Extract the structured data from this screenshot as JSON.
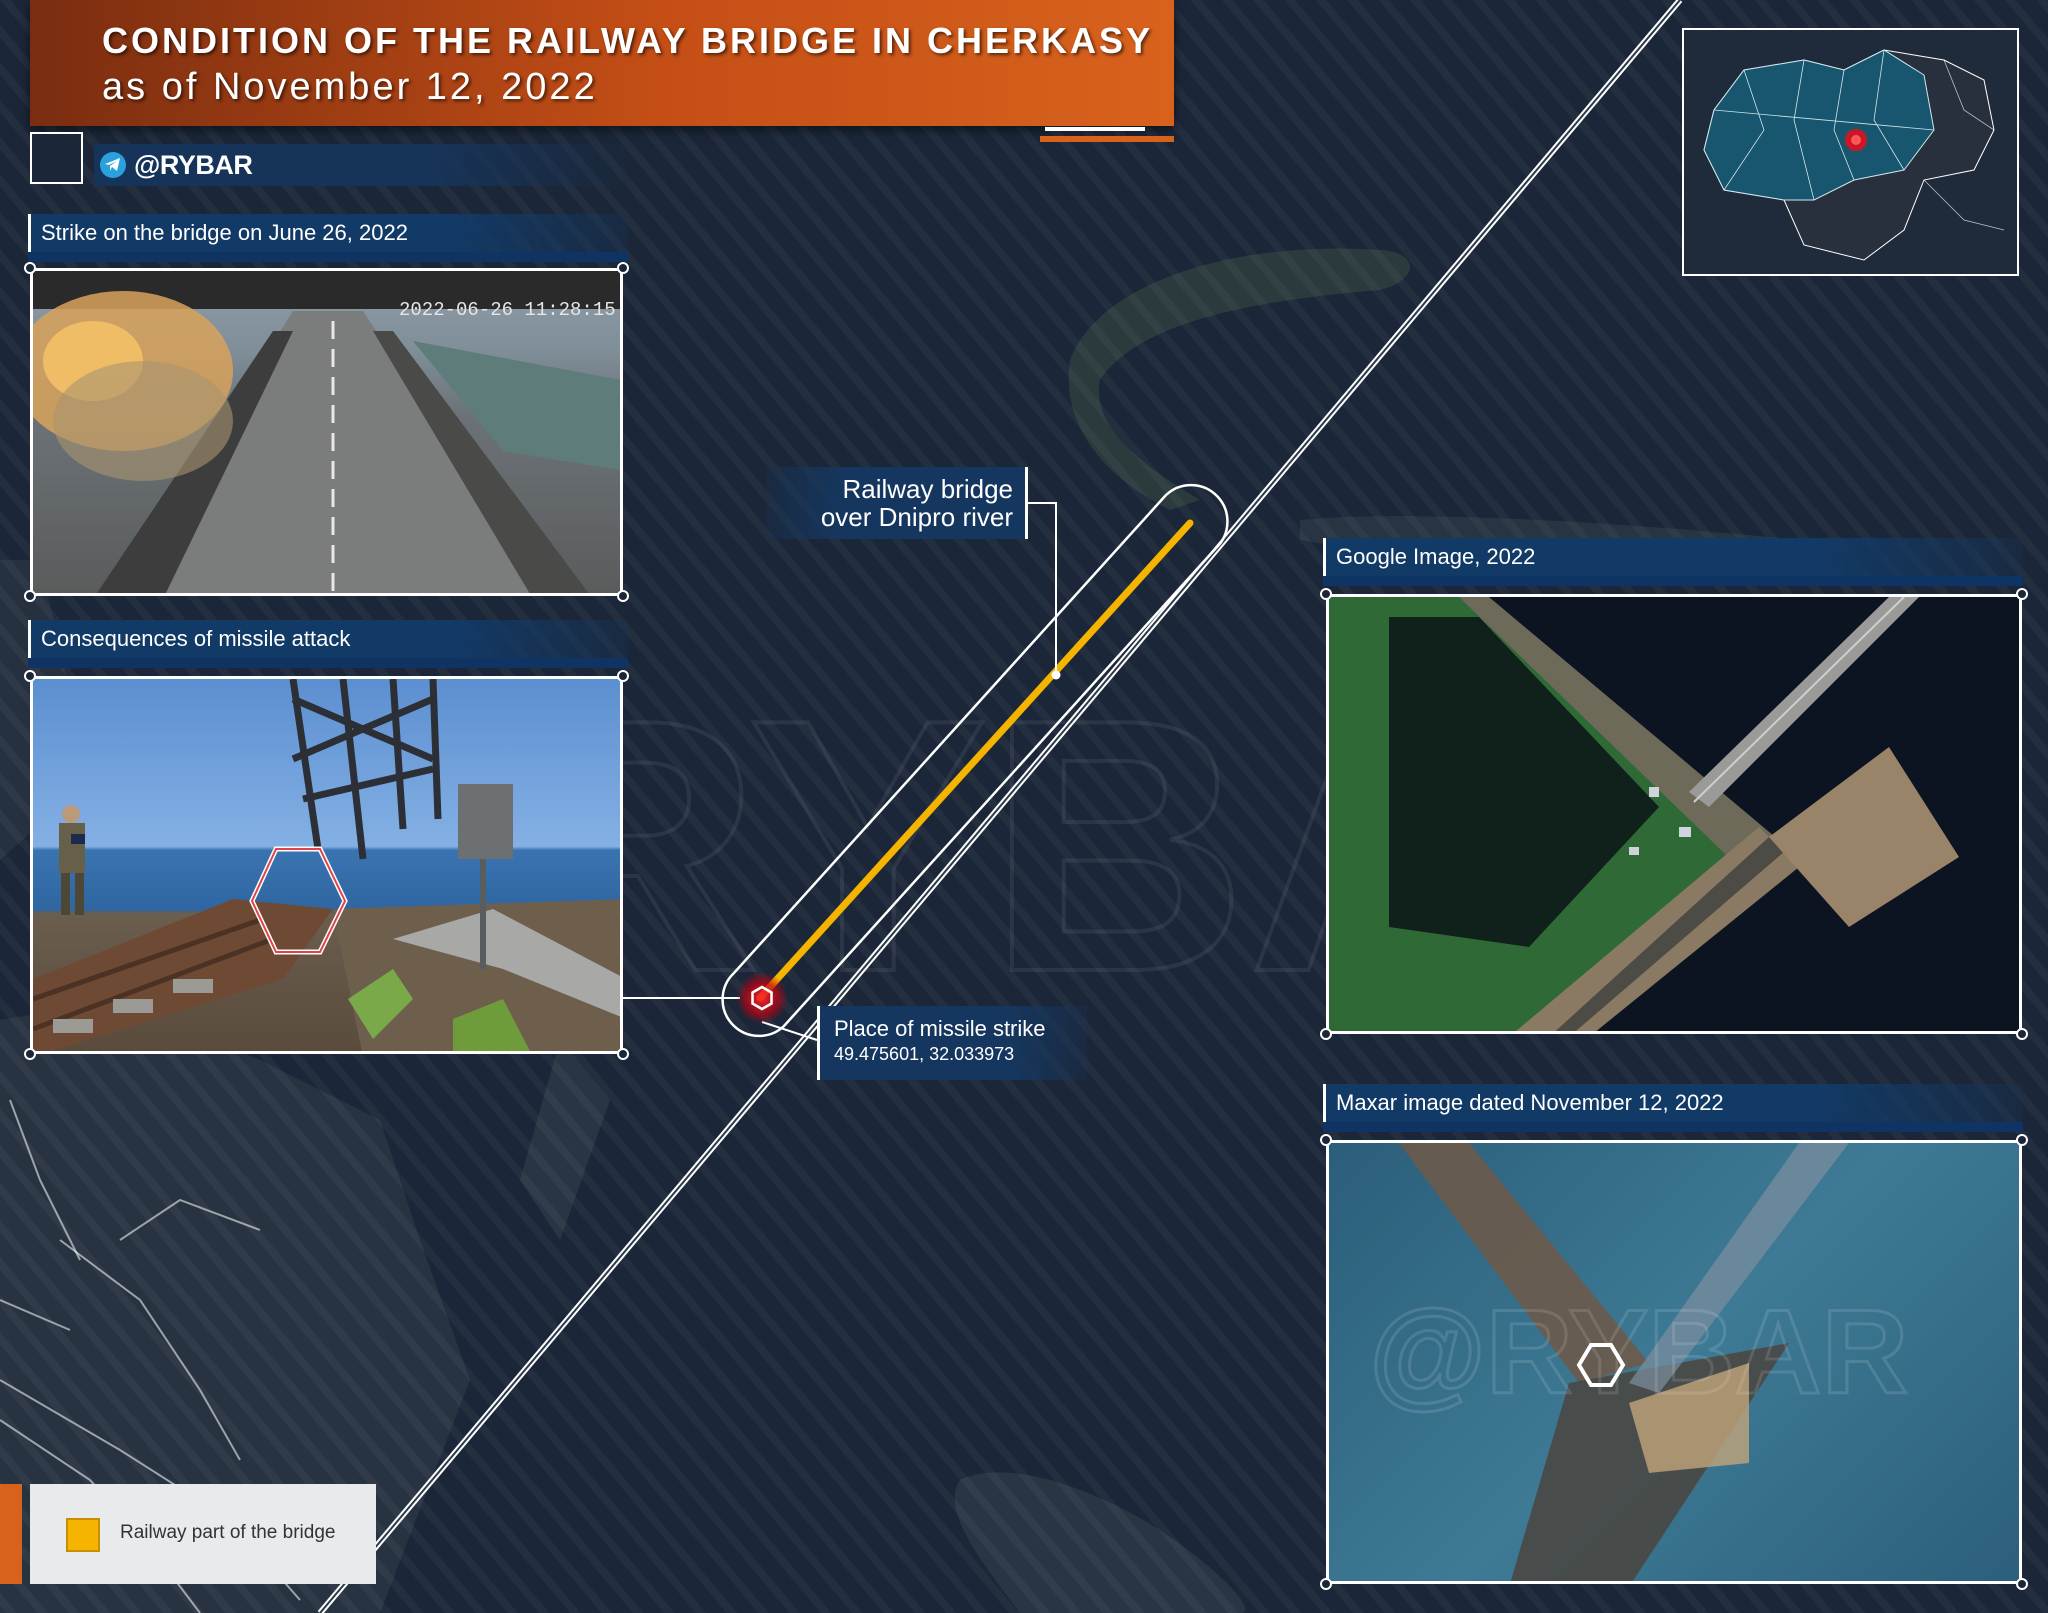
{
  "header": {
    "title": "CONDITION OF THE RAILWAY BRIDGE IN CHERKASY",
    "subtitle": "as of November 12, 2022",
    "brand": "@RYBAR"
  },
  "panels": {
    "strike": {
      "label": "Strike on the bridge on June 26, 2022",
      "timestamp": "2022-06-26 11:28:15"
    },
    "consequences": {
      "label": "Consequences of missile attack"
    },
    "google": {
      "label": "Google Image, 2022"
    },
    "maxar": {
      "label": "Maxar image dated November 12, 2022",
      "watermark": "@RYBAR"
    }
  },
  "callouts": {
    "railway_bridge": {
      "line1": "Railway bridge",
      "line2": "over Dnipro river"
    },
    "missile_strike": {
      "title": "Place of missile strike",
      "coords": "49.475601, 32.033973"
    }
  },
  "legend": {
    "items": [
      {
        "label": "Railway part of the bridge",
        "color": "#f5b400"
      }
    ]
  },
  "watermark": "@RYBAR",
  "colors": {
    "title_orange": "#d8621c",
    "label_blue": "#123a66",
    "railway_yellow": "#f5b400",
    "strike_red": "#e0101e",
    "water": "#1a2536"
  },
  "icons": [
    "telegram-icon",
    "strike-hexagon-icon",
    "hexagon-marker-icon"
  ]
}
